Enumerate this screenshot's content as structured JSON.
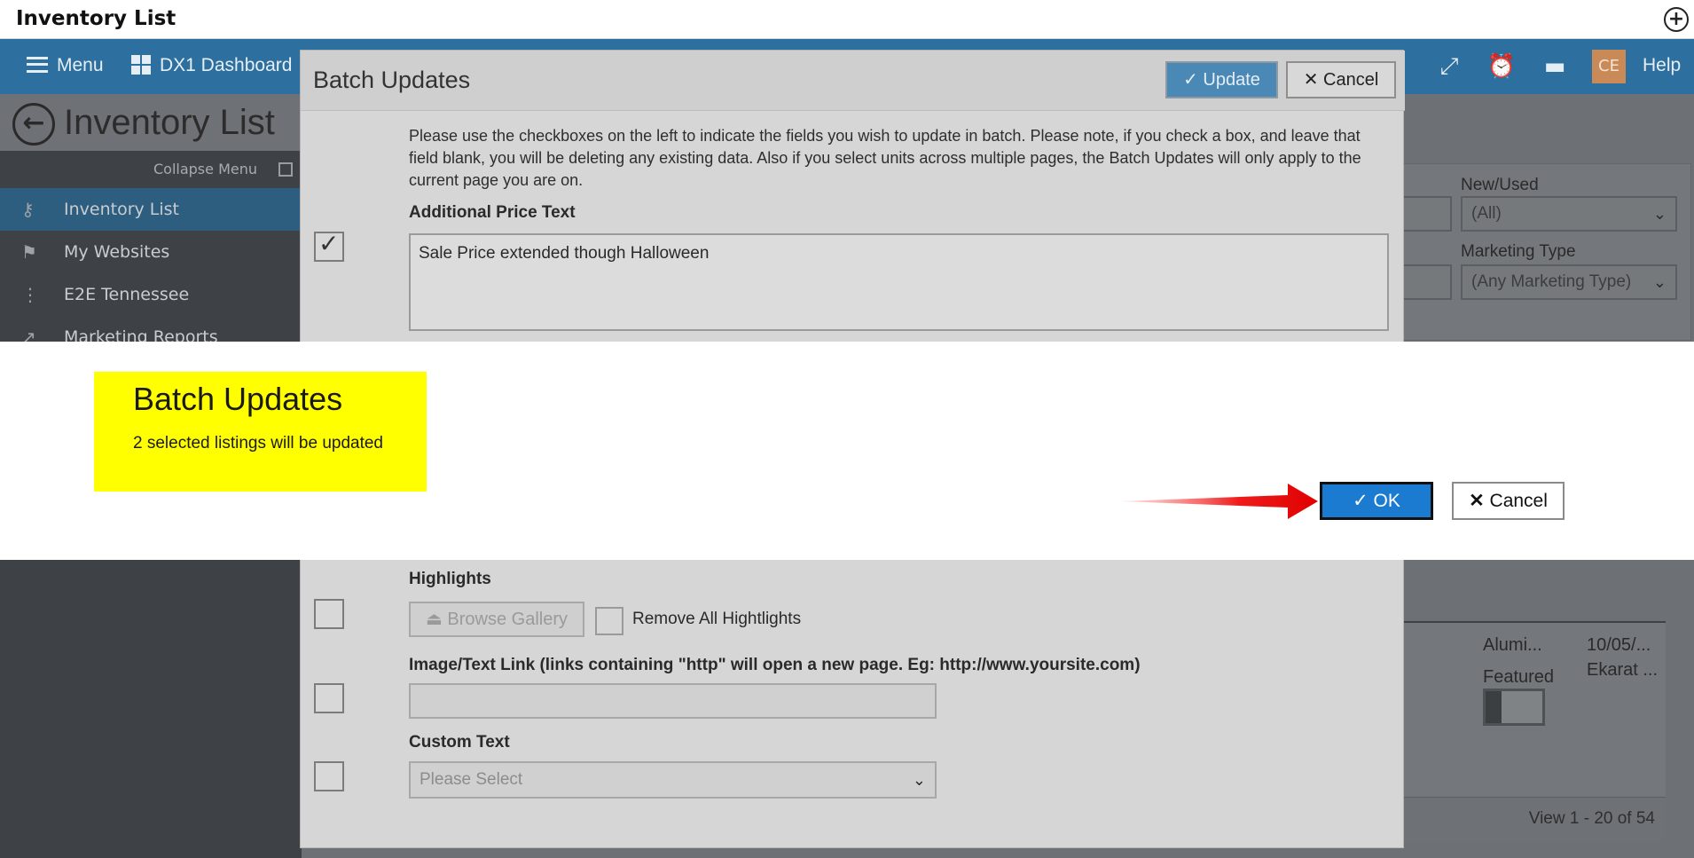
{
  "window": {
    "title": "Inventory List",
    "add_icon": "plus-circle-icon"
  },
  "topnav": {
    "menu_label": "Menu",
    "dashboard_label": "DX1 Dashboard",
    "avatar_initials": "CE",
    "help_label": "Help"
  },
  "page": {
    "title": "Inventory List"
  },
  "sidebar": {
    "collapse_label": "Collapse Menu",
    "items": [
      {
        "label": "Inventory List",
        "icon": "key-icon",
        "active": true
      },
      {
        "label": "My Websites",
        "icon": "flag-icon"
      },
      {
        "label": "E2E Tennessee",
        "icon": "chart-icon"
      },
      {
        "label": "Marketing Reports",
        "icon": "trend-icon"
      }
    ]
  },
  "filters": {
    "new_used_label": "New/Used",
    "new_used_value": "(All)",
    "marketing_type_label": "Marketing Type",
    "marketing_type_value": "(Any Marketing Type)"
  },
  "listing": {
    "col1": "Alumi...",
    "col2": "10/05/...",
    "col3": "Ekarat ...",
    "featured_label": "Featured",
    "pager": "View 1 - 20 of 54"
  },
  "batch_modal": {
    "title": "Batch Updates",
    "update_label": "Update",
    "cancel_label": "Cancel",
    "instructions": "Please use the checkboxes on the left to indicate the fields you wish to update in batch. Please note, if you check a box, and leave that field blank, you will be deleting any existing data. Also if you select units across multiple pages, the Batch Updates will only apply to the current page you are on.",
    "additional_price_label": "Additional Price Text",
    "additional_price_value": "Sale Price extended though Halloween",
    "highlights_label": "Highlights",
    "browse_gallery_label": "Browse Gallery",
    "remove_highlights_label": "Remove All Hightlights",
    "image_link_label": "Image/Text Link (links containing \"http\" will open a new page. Eg: http://www.yoursite.com)",
    "custom_text_label": "Custom Text",
    "custom_text_placeholder": "Please Select"
  },
  "confirm": {
    "title": "Batch Updates",
    "message": "2 selected listings will be updated",
    "ok_label": "OK",
    "cancel_label": "Cancel"
  },
  "colors": {
    "accent": "#1a7bd1",
    "highlight": "#ffff00",
    "arrow": "#e81010"
  }
}
